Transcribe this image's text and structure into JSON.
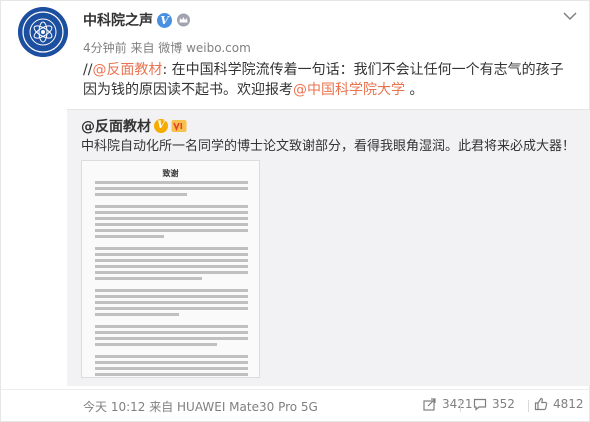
{
  "post": {
    "author": "中科院之声",
    "meta": "4分钟前 来自 微博 weibo.com",
    "text_prefix": "//",
    "mention1": "@反面教材",
    "text_mid": ": 在中国科学院流传着一句话：我们不会让任何一个有志气的孩子因为钱的原因读不起书。欢迎报考",
    "mention2": "@中国科学院大学",
    "text_suffix": " 。"
  },
  "repost": {
    "author": "@反面教材",
    "text": "中科院自动化所一名同学的博士论文致谢部分，看得我眼角湿润。此君将来必成大器！",
    "image_title": "致谢"
  },
  "footer": {
    "time_source": "今天 10:12 来自 HUAWEI Mate30 Pro 5G",
    "share_count": "3421",
    "comment_count": "352",
    "like_count": "4812"
  },
  "colors": {
    "link": "#eb7350",
    "verified": "#4a90e2",
    "muted": "#808080",
    "repost_bg": "#f2f2f5"
  },
  "icons": {
    "avatar": "cas-logo",
    "verified": "verified-v-icon",
    "crown": "crown-icon",
    "menu": "chevron-down-icon",
    "share": "share-icon",
    "comment": "comment-icon",
    "like": "thumbs-up-icon"
  }
}
